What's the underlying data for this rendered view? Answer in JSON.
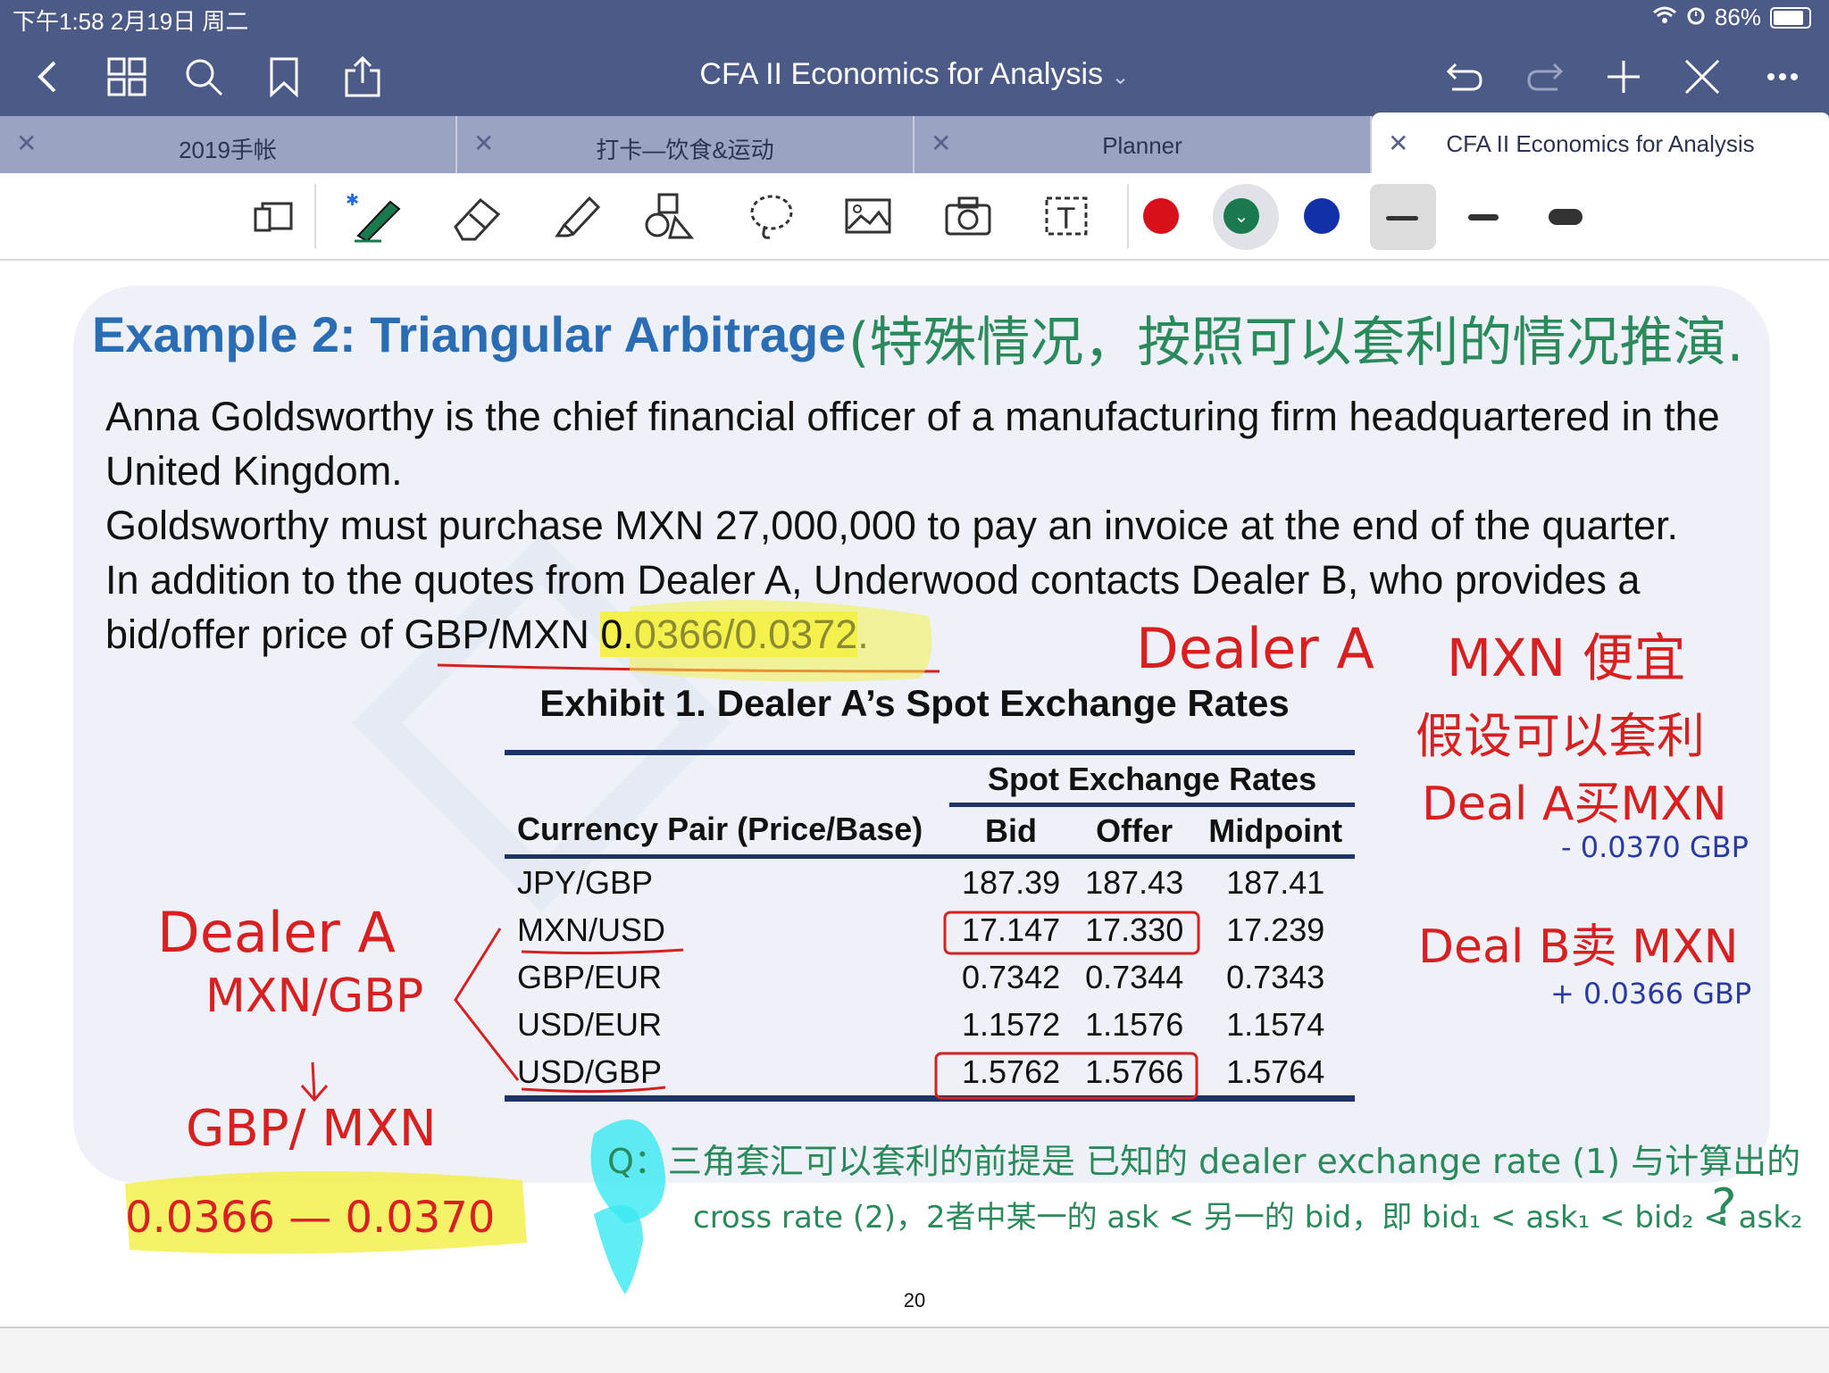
{
  "status": {
    "time_date": "下午1:58   2月19日 周二",
    "battery": "86%",
    "battery_level": 0.86
  },
  "nav": {
    "title": "CFA II Economics for Analysis",
    "icons": [
      "back-icon",
      "grid-icon",
      "search-icon",
      "bookmark-icon",
      "share-icon",
      "undo-icon",
      "redo-icon",
      "add-icon",
      "close-pen-icon",
      "more-icon"
    ]
  },
  "tabs": [
    {
      "label": "2019手帐"
    },
    {
      "label": "打卡—饮食&运动"
    },
    {
      "label": "Planner"
    },
    {
      "label": "CFA II Economics for Analysis",
      "active": true
    }
  ],
  "toolbar": {
    "tools": [
      "reading-mode-icon",
      "pen-icon",
      "eraser-icon",
      "highlighter-icon",
      "shapes-icon",
      "lasso-icon",
      "image-icon",
      "camera-icon",
      "text-icon"
    ],
    "colors": [
      "#d8101a",
      "#1a7a4e",
      "#1230a8"
    ],
    "stroke_sizes": [
      "thin",
      "medium",
      "thick"
    ]
  },
  "slide": {
    "title": "Example 2: Triangular Arbitrage",
    "paragraphs": [
      "Anna Goldsworthy is the chief financial officer of a manufacturing firm headquartered in the United Kingdom.",
      "Goldsworthy must purchase MXN 27,000,000 to pay an invoice at the end of the quarter.",
      "In addition to the quotes from Dealer A, Underwood contacts Dealer B, who provides a bid/offer price of GBP/MXN "
    ],
    "highlight_quote": "0.0366/0.0372",
    "highlight_suffix": ".",
    "exhibit_title": "Exhibit 1. Dealer A’s Spot Exchange Rates",
    "table": {
      "group_header": "Spot Exchange Rates",
      "headers": [
        "Currency Pair (Price/Base)",
        "Bid",
        "Offer",
        "Midpoint"
      ],
      "rows": [
        [
          "JPY/GBP",
          "187.39",
          "187.43",
          "187.41"
        ],
        [
          "MXN/USD",
          "17.147",
          "17.330",
          "17.239"
        ],
        [
          "GBP/EUR",
          "0.7342",
          "0.7344",
          "0.7343"
        ],
        [
          "USD/EUR",
          "1.1572",
          "1.1576",
          "1.1574"
        ],
        [
          "USD/GBP",
          "1.5762",
          "1.5766",
          "1.5764"
        ]
      ]
    },
    "page_number": "20"
  },
  "annotations": {
    "title_note": "(特殊情况，按照可以套利的情况推演.",
    "dealer_a_top": "Dealer A",
    "mxn_cheap": "MXN 便宜",
    "assume": "假设可以套利",
    "deal_a": "Deal A买MXN",
    "deal_a_amount": "- 0.0370 GBP",
    "deal_b": "Deal B卖 MXN",
    "deal_b_amount": "+ 0.0366 GBP",
    "left_dealer": "Dealer A",
    "left_pair": "MXN/GBP",
    "left_arrow": "↓",
    "left_inverse": "GBP/ MXN",
    "left_range": "0.0366 — 0.0370",
    "question_line1": "Q：三角套汇可以套利的前提是 已知的 dealer exchange rate (1) 与计算出的",
    "question_line2": "cross rate (2)，2者中某一的 ask < 另一的 bid，即 bid₁ < ask₁ < bid₂ < ask₂",
    "question_mark": "?"
  }
}
